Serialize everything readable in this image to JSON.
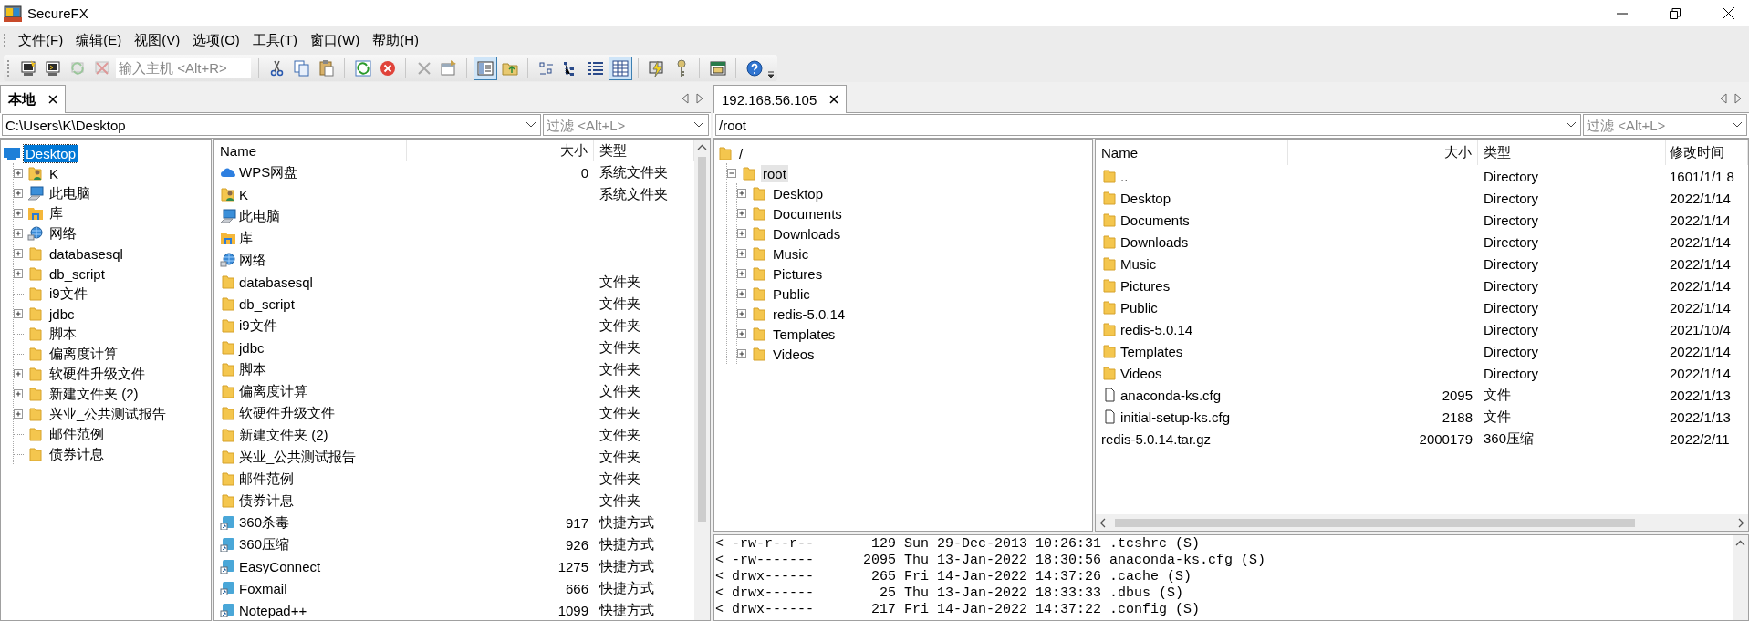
{
  "window": {
    "title": "SecureFX"
  },
  "menu": [
    "文件(F)",
    "编辑(E)",
    "视图(V)",
    "选项(O)",
    "工具(T)",
    "窗口(W)",
    "帮助(H)"
  ],
  "toolbar": {
    "items": [
      {
        "kind": "button",
        "pressed": false,
        "disabled": false
      },
      {
        "kind": "button",
        "pressed": false,
        "disabled": false
      },
      {
        "kind": "button",
        "pressed": false,
        "disabled": true
      },
      {
        "kind": "button",
        "pressed": false,
        "disabled": true
      },
      {
        "kind": "field",
        "placeholder": "输入主机 <Alt+R>"
      },
      {
        "kind": "separator"
      },
      {
        "kind": "button",
        "pressed": false,
        "disabled": false
      },
      {
        "kind": "button",
        "pressed": false,
        "disabled": false
      },
      {
        "kind": "button",
        "pressed": false,
        "disabled": false
      },
      {
        "kind": "separator"
      },
      {
        "kind": "button",
        "pressed": false,
        "disabled": false
      },
      {
        "kind": "button",
        "pressed": false,
        "disabled": false
      },
      {
        "kind": "separator"
      },
      {
        "kind": "button",
        "pressed": false,
        "disabled": true
      },
      {
        "kind": "button",
        "pressed": false,
        "disabled": false
      },
      {
        "kind": "separator"
      },
      {
        "kind": "button",
        "pressed": true,
        "disabled": false
      },
      {
        "kind": "button",
        "pressed": false,
        "disabled": false
      },
      {
        "kind": "separator"
      },
      {
        "kind": "button",
        "pressed": false,
        "disabled": false
      },
      {
        "kind": "button",
        "pressed": false,
        "disabled": false
      },
      {
        "kind": "button",
        "pressed": false,
        "disabled": false
      },
      {
        "kind": "button",
        "pressed": true,
        "disabled": false
      },
      {
        "kind": "separator"
      },
      {
        "kind": "button",
        "pressed": false,
        "disabled": false
      },
      {
        "kind": "button",
        "pressed": false,
        "disabled": false
      },
      {
        "kind": "separator"
      },
      {
        "kind": "button",
        "pressed": false,
        "disabled": false
      },
      {
        "kind": "separator"
      },
      {
        "kind": "button",
        "pressed": false,
        "disabled": false
      }
    ]
  },
  "local": {
    "tab": {
      "label": "本地",
      "selected": true
    },
    "path": "C:\\Users\\K\\Desktop",
    "filter_placeholder": "过滤 <Alt+L>",
    "tree": {
      "focused": true,
      "items": [
        {
          "label": "Desktop",
          "kind": "desktop",
          "selected": true,
          "children": [
            {
              "label": "K",
              "kind": "user",
              "expanded": false,
              "selected": false
            },
            {
              "label": "此电脑",
              "kind": "computer",
              "expanded": false,
              "selected": false
            },
            {
              "label": "库",
              "kind": "library",
              "expanded": false,
              "selected": false
            },
            {
              "label": "网络",
              "kind": "network",
              "expanded": false,
              "selected": false
            },
            {
              "label": "databasesql",
              "kind": "folder",
              "expanded": false,
              "selected": false
            },
            {
              "label": "db_script",
              "kind": "folder",
              "expanded": false,
              "selected": false
            },
            {
              "label": "i9文件",
              "kind": "folder",
              "selected": false
            },
            {
              "label": "jdbc",
              "kind": "folder",
              "expanded": false,
              "selected": false
            },
            {
              "label": "脚本",
              "kind": "folder",
              "selected": false
            },
            {
              "label": "偏离度计算",
              "kind": "folder",
              "selected": false
            },
            {
              "label": "软硬件升级文件",
              "kind": "folder",
              "expanded": false,
              "selected": false
            },
            {
              "label": "新建文件夹 (2)",
              "kind": "folder",
              "expanded": false,
              "selected": false
            },
            {
              "label": "兴业_公共测试报告",
              "kind": "folder",
              "expanded": false,
              "selected": false
            },
            {
              "label": "邮件范例",
              "kind": "folder",
              "selected": false
            },
            {
              "label": "债券计息",
              "kind": "folder",
              "selected": false
            }
          ]
        }
      ]
    },
    "list": {
      "columns": [
        "Name",
        "大小",
        "类型"
      ],
      "rows": [
        {
          "kind": "cloud",
          "name": "WPS网盘",
          "size": "0",
          "type": "系统文件夹"
        },
        {
          "kind": "user",
          "name": "K",
          "type": "系统文件夹"
        },
        {
          "kind": "computer",
          "name": "此电脑"
        },
        {
          "kind": "library",
          "name": "库"
        },
        {
          "kind": "network",
          "name": "网络"
        },
        {
          "kind": "folder",
          "name": "databasesql",
          "type": "文件夹"
        },
        {
          "kind": "folder",
          "name": "db_script",
          "type": "文件夹"
        },
        {
          "kind": "folder",
          "name": "i9文件",
          "type": "文件夹"
        },
        {
          "kind": "folder",
          "name": "jdbc",
          "type": "文件夹"
        },
        {
          "kind": "folder",
          "name": "脚本",
          "type": "文件夹"
        },
        {
          "kind": "folder",
          "name": "偏离度计算",
          "type": "文件夹"
        },
        {
          "kind": "folder",
          "name": "软硬件升级文件",
          "type": "文件夹"
        },
        {
          "kind": "folder",
          "name": "新建文件夹 (2)",
          "type": "文件夹"
        },
        {
          "kind": "folder",
          "name": "兴业_公共测试报告",
          "type": "文件夹"
        },
        {
          "kind": "folder",
          "name": "邮件范例",
          "type": "文件夹"
        },
        {
          "kind": "folder",
          "name": "债券计息",
          "type": "文件夹"
        },
        {
          "kind": "shortcut",
          "name": "360杀毒",
          "size": "917",
          "type": "快捷方式"
        },
        {
          "kind": "shortcut",
          "name": "360压缩",
          "size": "926",
          "type": "快捷方式"
        },
        {
          "kind": "shortcut",
          "name": "EasyConnect",
          "size": "1275",
          "type": "快捷方式"
        },
        {
          "kind": "shortcut",
          "name": "Foxmail",
          "size": "666",
          "type": "快捷方式"
        },
        {
          "kind": "shortcut",
          "name": "Notepad++",
          "size": "1099",
          "type": "快捷方式"
        }
      ]
    }
  },
  "remote": {
    "tab": {
      "label": "192.168.56.105",
      "selected": true
    },
    "path": "/root",
    "filter_placeholder": "过滤 <Alt+L>",
    "tree": {
      "focused": false,
      "items": [
        {
          "label": "/",
          "kind": "folder",
          "selected": false,
          "children": [
            {
              "label": "root",
              "kind": "folder",
              "expanded": true,
              "selected": true,
              "children": [
                {
                  "label": "Desktop",
                  "kind": "folder",
                  "expanded": false,
                  "selected": false
                },
                {
                  "label": "Documents",
                  "kind": "folder",
                  "expanded": false,
                  "selected": false
                },
                {
                  "label": "Downloads",
                  "kind": "folder",
                  "expanded": false,
                  "selected": false
                },
                {
                  "label": "Music",
                  "kind": "folder",
                  "expanded": false,
                  "selected": false
                },
                {
                  "label": "Pictures",
                  "kind": "folder",
                  "expanded": false,
                  "selected": false
                },
                {
                  "label": "Public",
                  "kind": "folder",
                  "expanded": false,
                  "selected": false
                },
                {
                  "label": "redis-5.0.14",
                  "kind": "folder",
                  "expanded": false,
                  "selected": false
                },
                {
                  "label": "Templates",
                  "kind": "folder",
                  "expanded": false,
                  "selected": false
                },
                {
                  "label": "Videos",
                  "kind": "folder",
                  "expanded": false,
                  "selected": false
                }
              ]
            }
          ]
        }
      ]
    },
    "list": {
      "columns": [
        "Name",
        "大小",
        "类型",
        "修改时间"
      ],
      "rows": [
        {
          "kind": "folder",
          "name": "..",
          "type": "Directory",
          "modified": "1601/1/1 8"
        },
        {
          "kind": "folder",
          "name": "Desktop",
          "type": "Directory",
          "modified": "2022/1/14"
        },
        {
          "kind": "folder",
          "name": "Documents",
          "type": "Directory",
          "modified": "2022/1/14"
        },
        {
          "kind": "folder",
          "name": "Downloads",
          "type": "Directory",
          "modified": "2022/1/14"
        },
        {
          "kind": "folder",
          "name": "Music",
          "type": "Directory",
          "modified": "2022/1/14"
        },
        {
          "kind": "folder",
          "name": "Pictures",
          "type": "Directory",
          "modified": "2022/1/14"
        },
        {
          "kind": "folder",
          "name": "Public",
          "type": "Directory",
          "modified": "2022/1/14"
        },
        {
          "kind": "folder",
          "name": "redis-5.0.14",
          "type": "Directory",
          "modified": "2021/10/4"
        },
        {
          "kind": "folder",
          "name": "Templates",
          "type": "Directory",
          "modified": "2022/1/14"
        },
        {
          "kind": "folder",
          "name": "Videos",
          "type": "Directory",
          "modified": "2022/1/14"
        },
        {
          "kind": "file",
          "name": "anaconda-ks.cfg",
          "size": "2095",
          "type": "文件",
          "modified": "2022/1/13"
        },
        {
          "kind": "file",
          "name": "initial-setup-ks.cfg",
          "size": "2188",
          "type": "文件",
          "modified": "2022/1/13"
        },
        {
          "kind": "none",
          "name": "redis-5.0.14.tar.gz",
          "size": "2000179",
          "type": "360压缩",
          "modified": "2022/2/11"
        }
      ]
    },
    "log": [
      "< -rw-r--r--       129 Sun 29-Dec-2013 10:26:31 .tcshrc (S)",
      "< -rw-------      2095 Thu 13-Jan-2022 18:30:56 anaconda-ks.cfg (S)",
      "< drwx------       265 Fri 14-Jan-2022 14:37:26 .cache (S)",
      "< drwx------        25 Thu 13-Jan-2022 18:33:33 .dbus (S)",
      "< drwx------       217 Fri 14-Jan-2022 14:37:22 .config (S)"
    ]
  }
}
